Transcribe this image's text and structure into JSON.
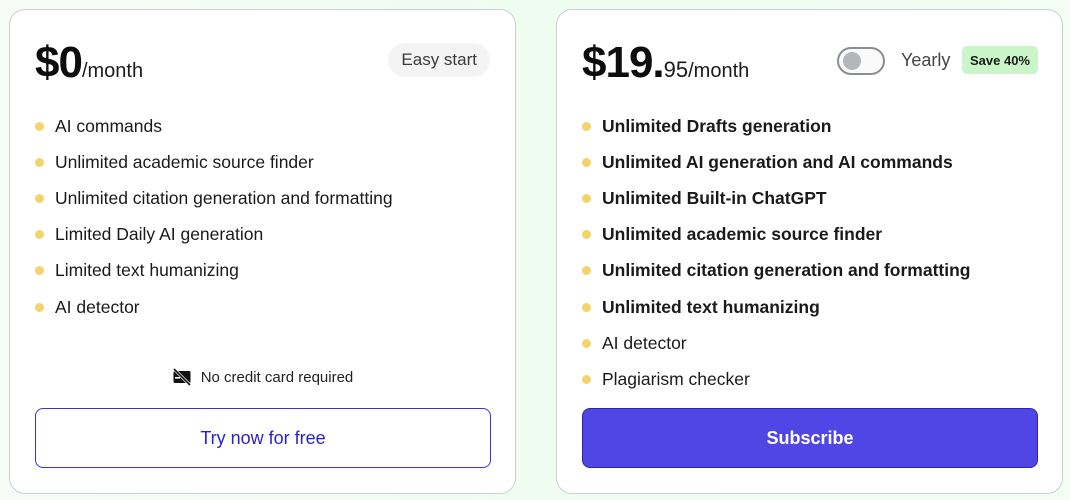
{
  "free_plan": {
    "price_main": "$0",
    "price_period": "/month",
    "badge": "Easy start",
    "features": [
      {
        "text": "AI commands"
      },
      {
        "text": "Unlimited academic source finder"
      },
      {
        "text": "Unlimited citation generation and formatting"
      },
      {
        "text": "Limited Daily AI generation"
      },
      {
        "text": "Limited text humanizing"
      },
      {
        "text": "AI detector"
      }
    ],
    "no_card_text": "No credit card required",
    "cta_label": "Try now for free"
  },
  "pro_plan": {
    "price_main": "$19.",
    "price_cents": "95",
    "price_period": "/month",
    "toggle_label": "Yearly",
    "toggle_on": false,
    "save_badge": "Save 40%",
    "features": [
      {
        "text": "Unlimited Drafts generation",
        "bold": true
      },
      {
        "text": "Unlimited AI generation and AI commands",
        "bold": true
      },
      {
        "text": "Unlimited Built-in ChatGPT",
        "bold": true
      },
      {
        "text": "Unlimited academic source finder",
        "bold": true
      },
      {
        "text": "Unlimited citation generation and formatting",
        "bold": true
      },
      {
        "text": "Unlimited text humanizing",
        "bold": true
      },
      {
        "text": "AI detector",
        "bold": false
      },
      {
        "text": "Plagiarism checker",
        "bold": false
      }
    ],
    "cta_label": "Subscribe"
  },
  "colors": {
    "accent": "#4f46e5",
    "bullet": "#f2d46b",
    "save_badge_bg": "#c9f5c9"
  }
}
